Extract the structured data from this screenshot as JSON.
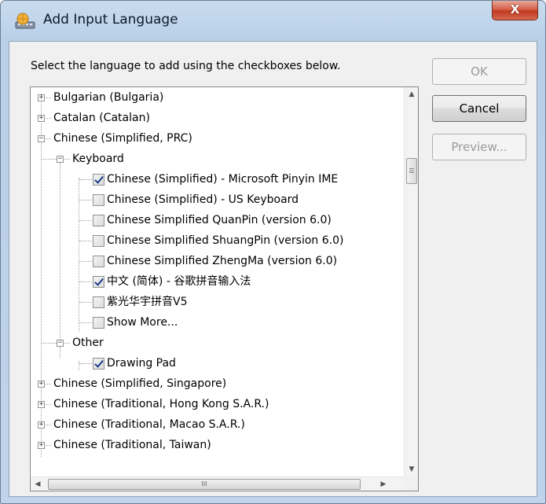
{
  "window": {
    "title": "Add Input Language",
    "close_label": "X"
  },
  "instruction": "Select the language to add using the checkboxes below.",
  "buttons": {
    "ok": "OK",
    "cancel": "Cancel",
    "preview": "Preview..."
  },
  "tree": {
    "bulgarian": "Bulgarian (Bulgaria)",
    "catalan": "Catalan (Catalan)",
    "chinese_prc": "Chinese (Simplified, PRC)",
    "keyboard": "Keyboard",
    "kb_items": [
      {
        "label": "Chinese (Simplified) - Microsoft Pinyin IME",
        "checked": true
      },
      {
        "label": "Chinese (Simplified) - US Keyboard",
        "checked": false
      },
      {
        "label": "Chinese Simplified QuanPin (version 6.0)",
        "checked": false
      },
      {
        "label": "Chinese Simplified ShuangPin (version 6.0)",
        "checked": false
      },
      {
        "label": "Chinese Simplified ZhengMa (version 6.0)",
        "checked": false
      },
      {
        "label": "中文 (简体) - 谷歌拼音输入法",
        "checked": true
      },
      {
        "label": "紫光华宇拼音V5",
        "checked": false
      },
      {
        "label": "Show More...",
        "checked": false
      }
    ],
    "other": "Other",
    "drawing_pad": {
      "label": "Drawing Pad",
      "checked": true
    },
    "singapore": "Chinese (Simplified, Singapore)",
    "hongkong": "Chinese (Traditional, Hong Kong S.A.R.)",
    "macao": "Chinese (Traditional, Macao S.A.R.)",
    "taiwan": "Chinese (Traditional, Taiwan)"
  },
  "scrollbar": {
    "up_arrow": "▲",
    "down_arrow": "▼",
    "left_arrow": "◀",
    "right_arrow": "▶",
    "v_grip": "☰",
    "h_grip": "III"
  }
}
